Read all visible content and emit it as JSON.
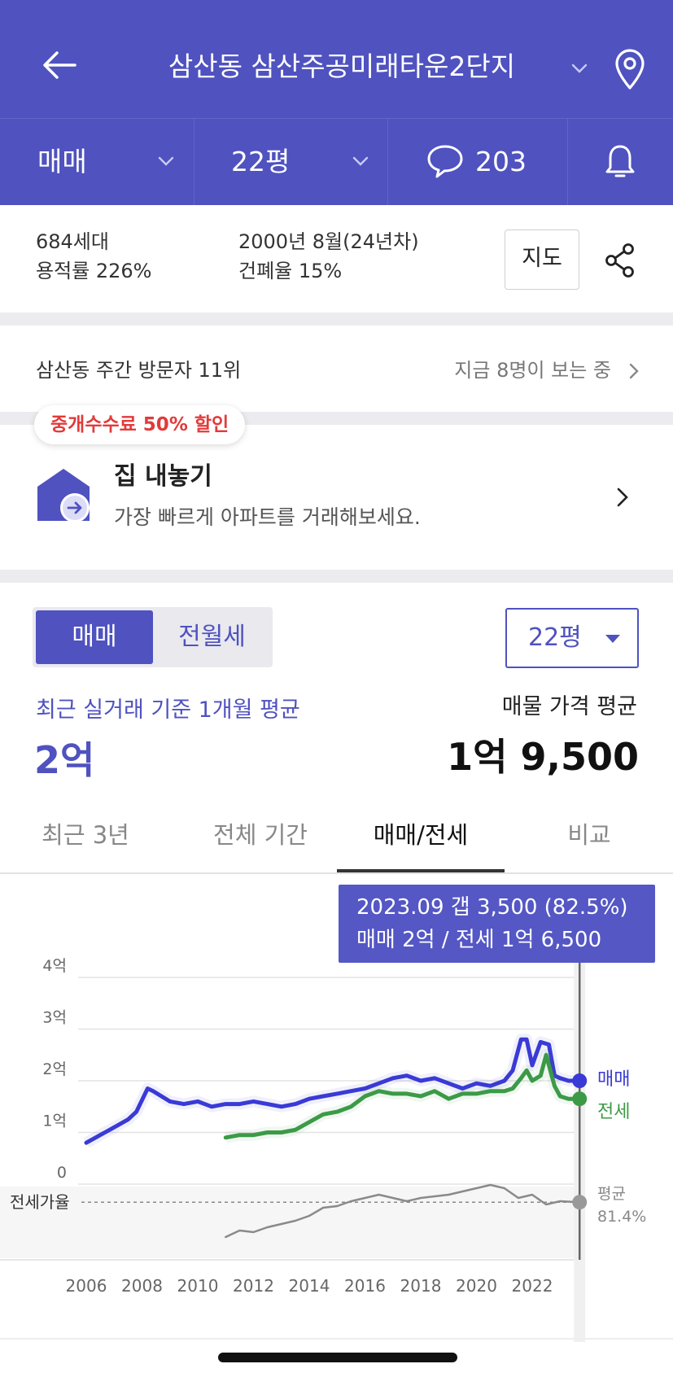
{
  "header": {
    "title": "삼산동 삼산주공미래타운2단지",
    "trade_type": "매매",
    "size": "22평",
    "comment_count": "203"
  },
  "info": {
    "households": "684세대",
    "floor_area_ratio": "용적률 226%",
    "built": "2000년 8월(24년차)",
    "building_coverage": "건폐율 15%",
    "map_button": "지도"
  },
  "visitors": {
    "rank": "삼산동 주간 방문자 11위",
    "watching": "지금 8명이 보는 중"
  },
  "sell": {
    "badge": "중개수수료 50% 할인",
    "title": "집 내놓기",
    "subtitle": "가장 빠르게 아파트를 거래해보세요."
  },
  "price": {
    "toggle": [
      "매매",
      "전월세"
    ],
    "size_select": "22평",
    "recent_label": "최근 실거래 기준 1개월 평균",
    "recent_value": "2억",
    "listing_label": "매물 가격 평균",
    "listing_value": "1억 9,500"
  },
  "tabs": [
    "최근 3년",
    "전체 기간",
    "매매/전세",
    "비교"
  ],
  "tooltip": {
    "line1": "2023.09  갭 3,500 (82.5%)",
    "line2": "매매 2억 / 전세 1억 6,500"
  },
  "colors": {
    "brand": "#4f52bf",
    "sale": "#3a3ad6",
    "jeonse": "#3c9a47",
    "ratio": "#8a8a8a",
    "discount": "#e23a3a"
  },
  "chart_data": {
    "type": "line",
    "y_ticks": [
      "4억",
      "3억",
      "2억",
      "1억",
      "0"
    ],
    "x_ticks": [
      "2006",
      "2008",
      "2010",
      "2012",
      "2014",
      "2016",
      "2018",
      "2020",
      "2022"
    ],
    "ratio_label": "전세가율",
    "ylim": [
      0,
      4
    ],
    "unit": "억",
    "series": [
      {
        "name": "매매",
        "x": [
          2006.0,
          2006.5,
          2007.0,
          2007.5,
          2007.8,
          2008.2,
          2008.4,
          2009.0,
          2009.5,
          2010.0,
          2010.5,
          2011.0,
          2011.5,
          2012.0,
          2012.5,
          2013.0,
          2013.5,
          2014.0,
          2014.5,
          2015.0,
          2015.5,
          2016.0,
          2016.5,
          2017.0,
          2017.5,
          2018.0,
          2018.5,
          2019.0,
          2019.5,
          2020.0,
          2020.5,
          2021.0,
          2021.3,
          2021.6,
          2021.8,
          2022.0,
          2022.3,
          2022.6,
          2022.8,
          2023.0,
          2023.3,
          2023.7
        ],
        "values": [
          0.8,
          0.95,
          1.1,
          1.25,
          1.4,
          1.85,
          1.8,
          1.6,
          1.55,
          1.6,
          1.5,
          1.55,
          1.55,
          1.6,
          1.55,
          1.5,
          1.55,
          1.65,
          1.7,
          1.75,
          1.8,
          1.85,
          1.95,
          2.05,
          2.1,
          2.0,
          2.05,
          1.95,
          1.85,
          1.95,
          1.9,
          2.0,
          2.2,
          2.8,
          2.8,
          2.3,
          2.75,
          2.7,
          2.1,
          2.05,
          2.0,
          2.0
        ]
      },
      {
        "name": "전세",
        "x": [
          2011.0,
          2011.5,
          2012.0,
          2012.5,
          2013.0,
          2013.5,
          2014.0,
          2014.5,
          2015.0,
          2015.5,
          2016.0,
          2016.5,
          2017.0,
          2017.5,
          2018.0,
          2018.5,
          2019.0,
          2019.5,
          2020.0,
          2020.5,
          2021.0,
          2021.3,
          2021.6,
          2021.8,
          2022.0,
          2022.3,
          2022.5,
          2022.8,
          2023.0,
          2023.3,
          2023.7
        ],
        "values": [
          0.9,
          0.95,
          0.95,
          1.0,
          1.0,
          1.05,
          1.2,
          1.35,
          1.4,
          1.5,
          1.7,
          1.8,
          1.75,
          1.75,
          1.7,
          1.8,
          1.65,
          1.75,
          1.75,
          1.8,
          1.8,
          1.85,
          2.05,
          2.2,
          2.0,
          2.1,
          2.5,
          1.9,
          1.7,
          1.65,
          1.65
        ]
      },
      {
        "name": "전세가율",
        "x": [
          2011.0,
          2011.5,
          2012.0,
          2012.5,
          2013.0,
          2013.5,
          2014.0,
          2014.5,
          2015.0,
          2015.5,
          2016.0,
          2016.5,
          2017.0,
          2017.5,
          2018.0,
          2018.5,
          2019.0,
          2019.5,
          2020.0,
          2020.5,
          2021.0,
          2021.5,
          2022.0,
          2022.5,
          2023.0,
          2023.7
        ],
        "values": [
          60,
          64,
          63,
          66,
          68,
          70,
          73,
          78,
          79,
          82,
          84,
          86,
          84,
          82,
          84,
          85,
          86,
          88,
          90,
          92,
          90,
          84,
          86,
          80,
          82,
          81.4
        ]
      }
    ],
    "selected": {
      "x": 2023.7,
      "sale": 2.0,
      "jeonse": 1.65
    },
    "end_labels": {
      "sale": "매매",
      "jeonse": "전세",
      "ratio_title": "평균",
      "ratio_value": "81.4%"
    }
  }
}
